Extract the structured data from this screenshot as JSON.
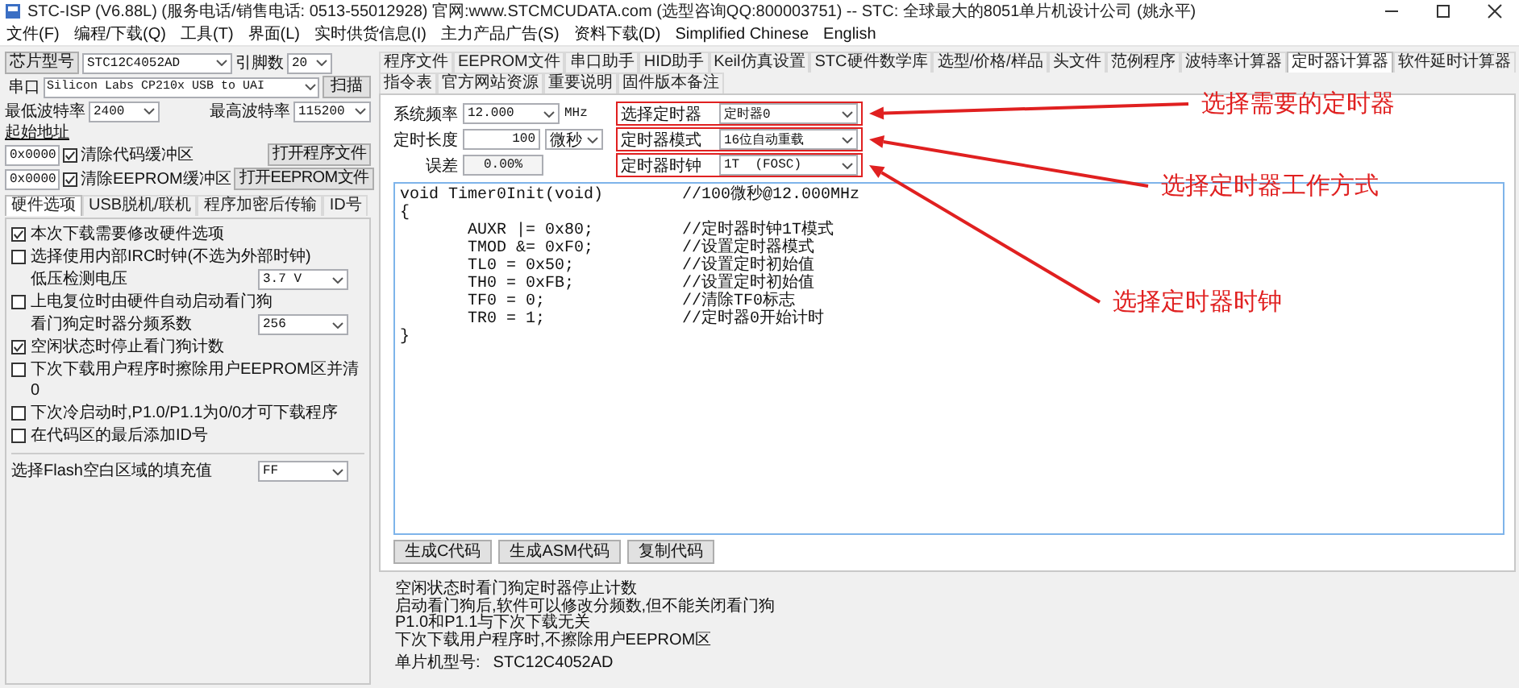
{
  "window": {
    "title": "STC-ISP (V6.88L) (服务电话/销售电话: 0513-55012928) 官网:www.STCMCUDATA.com  (选型咨询QQ:800003751) -- STC: 全球最大的8051单片机设计公司 (姚永平)"
  },
  "menu": [
    "文件(F)",
    "编程/下载(Q)",
    "工具(T)",
    "界面(L)",
    "实时供货信息(I)",
    "主力产品广告(S)",
    "资料下载(D)",
    "Simplified Chinese",
    "English"
  ],
  "chip": {
    "label": "芯片型号",
    "value": "STC12C4052AD",
    "pins_label": "引脚数",
    "pins": "20"
  },
  "port": {
    "label": "串口",
    "value": "Silicon Labs CP210x USB to UAI",
    "scan_button": "扫描"
  },
  "baud": {
    "min_label": "最低波特率",
    "min": "2400",
    "max_label": "最高波特率",
    "max": "115200"
  },
  "start_address": {
    "label": "起始地址",
    "rows": [
      {
        "value": "0x0000",
        "checkbox": "清除代码缓冲区",
        "checked": true,
        "button": "打开程序文件"
      },
      {
        "value": "0x0000",
        "checkbox": "清除EEPROM缓冲区",
        "checked": true,
        "button": "打开EEPROM文件"
      }
    ]
  },
  "left_tabs": [
    {
      "label": "硬件选项",
      "selected": true
    },
    {
      "label": "USB脱机/联机",
      "selected": false
    },
    {
      "label": "程序加密后传输",
      "selected": false
    },
    {
      "label": "ID号",
      "selected": false
    }
  ],
  "hardware_options": [
    {
      "kind": "checkbox",
      "label": "本次下载需要修改硬件选项",
      "checked": true
    },
    {
      "kind": "checkbox",
      "label": "选择使用内部IRC时钟(不选为外部时钟)",
      "checked": false
    },
    {
      "kind": "select",
      "label": "低压检测电压",
      "value": "3.7 V"
    },
    {
      "kind": "checkbox",
      "label": "上电复位时由硬件自动启动看门狗",
      "checked": false
    },
    {
      "kind": "select",
      "label": "看门狗定时器分频系数",
      "value": "256"
    },
    {
      "kind": "checkbox",
      "label": "空闲状态时停止看门狗计数",
      "checked": true
    },
    {
      "kind": "checkbox",
      "label": "下次下载用户程序时擦除用户EEPROM区并清0",
      "checked": false
    },
    {
      "kind": "checkbox",
      "label": "下次冷启动时,P1.0/P1.1为0/0才可下载程序",
      "checked": false
    },
    {
      "kind": "checkbox",
      "label": "在代码区的最后添加ID号",
      "checked": false
    },
    {
      "kind": "select",
      "label": "选择Flash空白区域的填充值",
      "value": "FF"
    }
  ],
  "tabs": [
    {
      "label": "程序文件",
      "selected": false
    },
    {
      "label": "EEPROM文件",
      "selected": false
    },
    {
      "label": "串口助手",
      "selected": false
    },
    {
      "label": "HID助手",
      "selected": false
    },
    {
      "label": "Keil仿真设置",
      "selected": false
    },
    {
      "label": "STC硬件数学库",
      "selected": false
    },
    {
      "label": "选型/价格/样品",
      "selected": false
    },
    {
      "label": "头文件",
      "selected": false
    },
    {
      "label": "范例程序",
      "selected": false
    },
    {
      "label": "波特率计算器",
      "selected": false
    },
    {
      "label": "定时器计算器",
      "selected": true
    },
    {
      "label": "软件延时计算器",
      "selected": false
    },
    {
      "label": "指令表",
      "selected": false
    },
    {
      "label": "官方网站资源",
      "selected": false
    },
    {
      "label": "重要说明",
      "selected": false
    },
    {
      "label": "固件版本备注",
      "selected": false
    }
  ],
  "timer": {
    "fields": [
      {
        "kind": "select",
        "label": "系统频率",
        "value": "12.000",
        "unit": "MHz"
      },
      {
        "kind": "input",
        "label": "定时长度",
        "value": "100",
        "unit_select": "微秒"
      },
      {
        "kind": "readout",
        "label": "误差",
        "value": "0.00%"
      }
    ],
    "options": [
      {
        "label": "选择定时器",
        "value": "定时器0",
        "highlighted": true
      },
      {
        "label": "定时器模式",
        "value": "16位自动重载",
        "highlighted": true
      },
      {
        "label": "定时器时钟",
        "value": "1T  (FOSC)",
        "highlighted": true
      }
    ]
  },
  "code": [
    {
      "code": "void Timer0Init(void)",
      "comment": "//100微秒@12.000MHz",
      "indented": false
    },
    {
      "code": "{",
      "indented": false
    },
    {
      "code": "AUXR |= 0x80;",
      "comment": "//定时器时钟1T模式",
      "indented": true
    },
    {
      "code": "TMOD &= 0xF0;",
      "comment": "//设置定时器模式",
      "indented": true
    },
    {
      "code": "TL0 = 0x50;",
      "comment": "//设置定时初始值",
      "indented": true
    },
    {
      "code": "TH0 = 0xFB;",
      "comment": "//设置定时初始值",
      "indented": true
    },
    {
      "code": "TF0 = 0;",
      "comment": "//清除TF0标志",
      "indented": true
    },
    {
      "code": "TR0 = 1;",
      "comment": "//定时器0开始计时",
      "indented": true
    },
    {
      "code": "}",
      "indented": false
    }
  ],
  "buttons": [
    "生成C代码",
    "生成ASM代码",
    "复制代码"
  ],
  "log": {
    "lines": [
      "空闲状态时看门狗定时器停止计数",
      "启动看门狗后,软件可以修改分频数,但不能关闭看门狗",
      "P1.0和P1.1与下次下载无关",
      "下次下载用户程序时,不擦除用户EEPROM区"
    ],
    "chip_label": "单片机型号:",
    "chip_value": "STC12C4052AD"
  },
  "annotations": [
    {
      "text": "选择需要的定时器"
    },
    {
      "text": "选择定时器工作方式"
    },
    {
      "text": "选择定时器时钟"
    }
  ]
}
